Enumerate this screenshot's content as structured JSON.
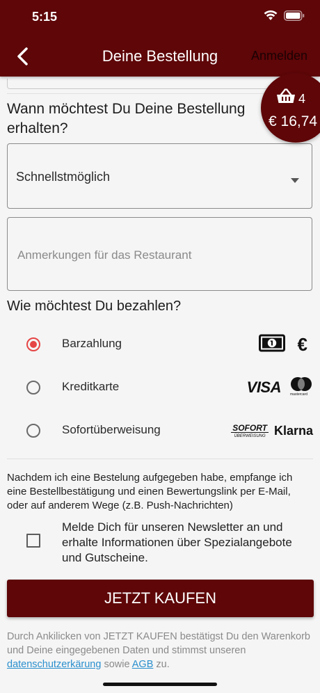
{
  "status_bar": {
    "time": "5:15"
  },
  "header": {
    "title": "Deine Bestellung",
    "login_label": "Anmelden"
  },
  "cart": {
    "count": "4",
    "total": "€ 16,74"
  },
  "delivery": {
    "question": "Wann möchtest Du Deine Bestellung erhalten?",
    "selected_option": "Schnellstmöglich"
  },
  "notes": {
    "placeholder": "Anmerkungen für das Restaurant"
  },
  "payment": {
    "question": "Wie möchtest Du bezahlen?",
    "methods": [
      {
        "label": "Barzahlung",
        "selected": true,
        "icons": [
          "banknote-icon",
          "euro-icon"
        ]
      },
      {
        "label": "Kreditkarte",
        "selected": false,
        "icons": [
          "visa-logo",
          "mastercard-logo"
        ]
      },
      {
        "label": "Sofortüberweisung",
        "selected": false,
        "icons": [
          "sofort-logo",
          "klarna-logo"
        ]
      }
    ],
    "logos": {
      "euro": "€",
      "visa": "VISA",
      "mastercard": "mastercard",
      "sofort": "SOFORT",
      "sofort_sub": "ÜBERWEISUNG",
      "klarna": "Klarna"
    }
  },
  "consent_text": "Nachdem ich eine Bestelung aufgegeben habe, empfange ich eine Bestellbestätigung und einen Bewertungslink per E-Mail, oder auf anderem Wege (z.B. Push-Nachrichten)",
  "newsletter": {
    "label": "Melde Dich für unseren Newsletter an und erhalte Informationen über Spezialangebote und Gutscheine.",
    "checked": false
  },
  "buy_button_label": "JETZT KAUFEN",
  "legal": {
    "text_before": "Durch Ankilicken von JETZT KAUFEN bestätigst Du den Warenkorb und Deine eingegebenen Daten und stimmst unseren ",
    "privacy_link": "datenschutzerkärung",
    "middle": " sowie ",
    "terms_link": "AGB",
    "text_after": " zu."
  },
  "colors": {
    "brand": "#5e0608",
    "radio_selected": "#e64545",
    "link": "#2a8fce"
  }
}
